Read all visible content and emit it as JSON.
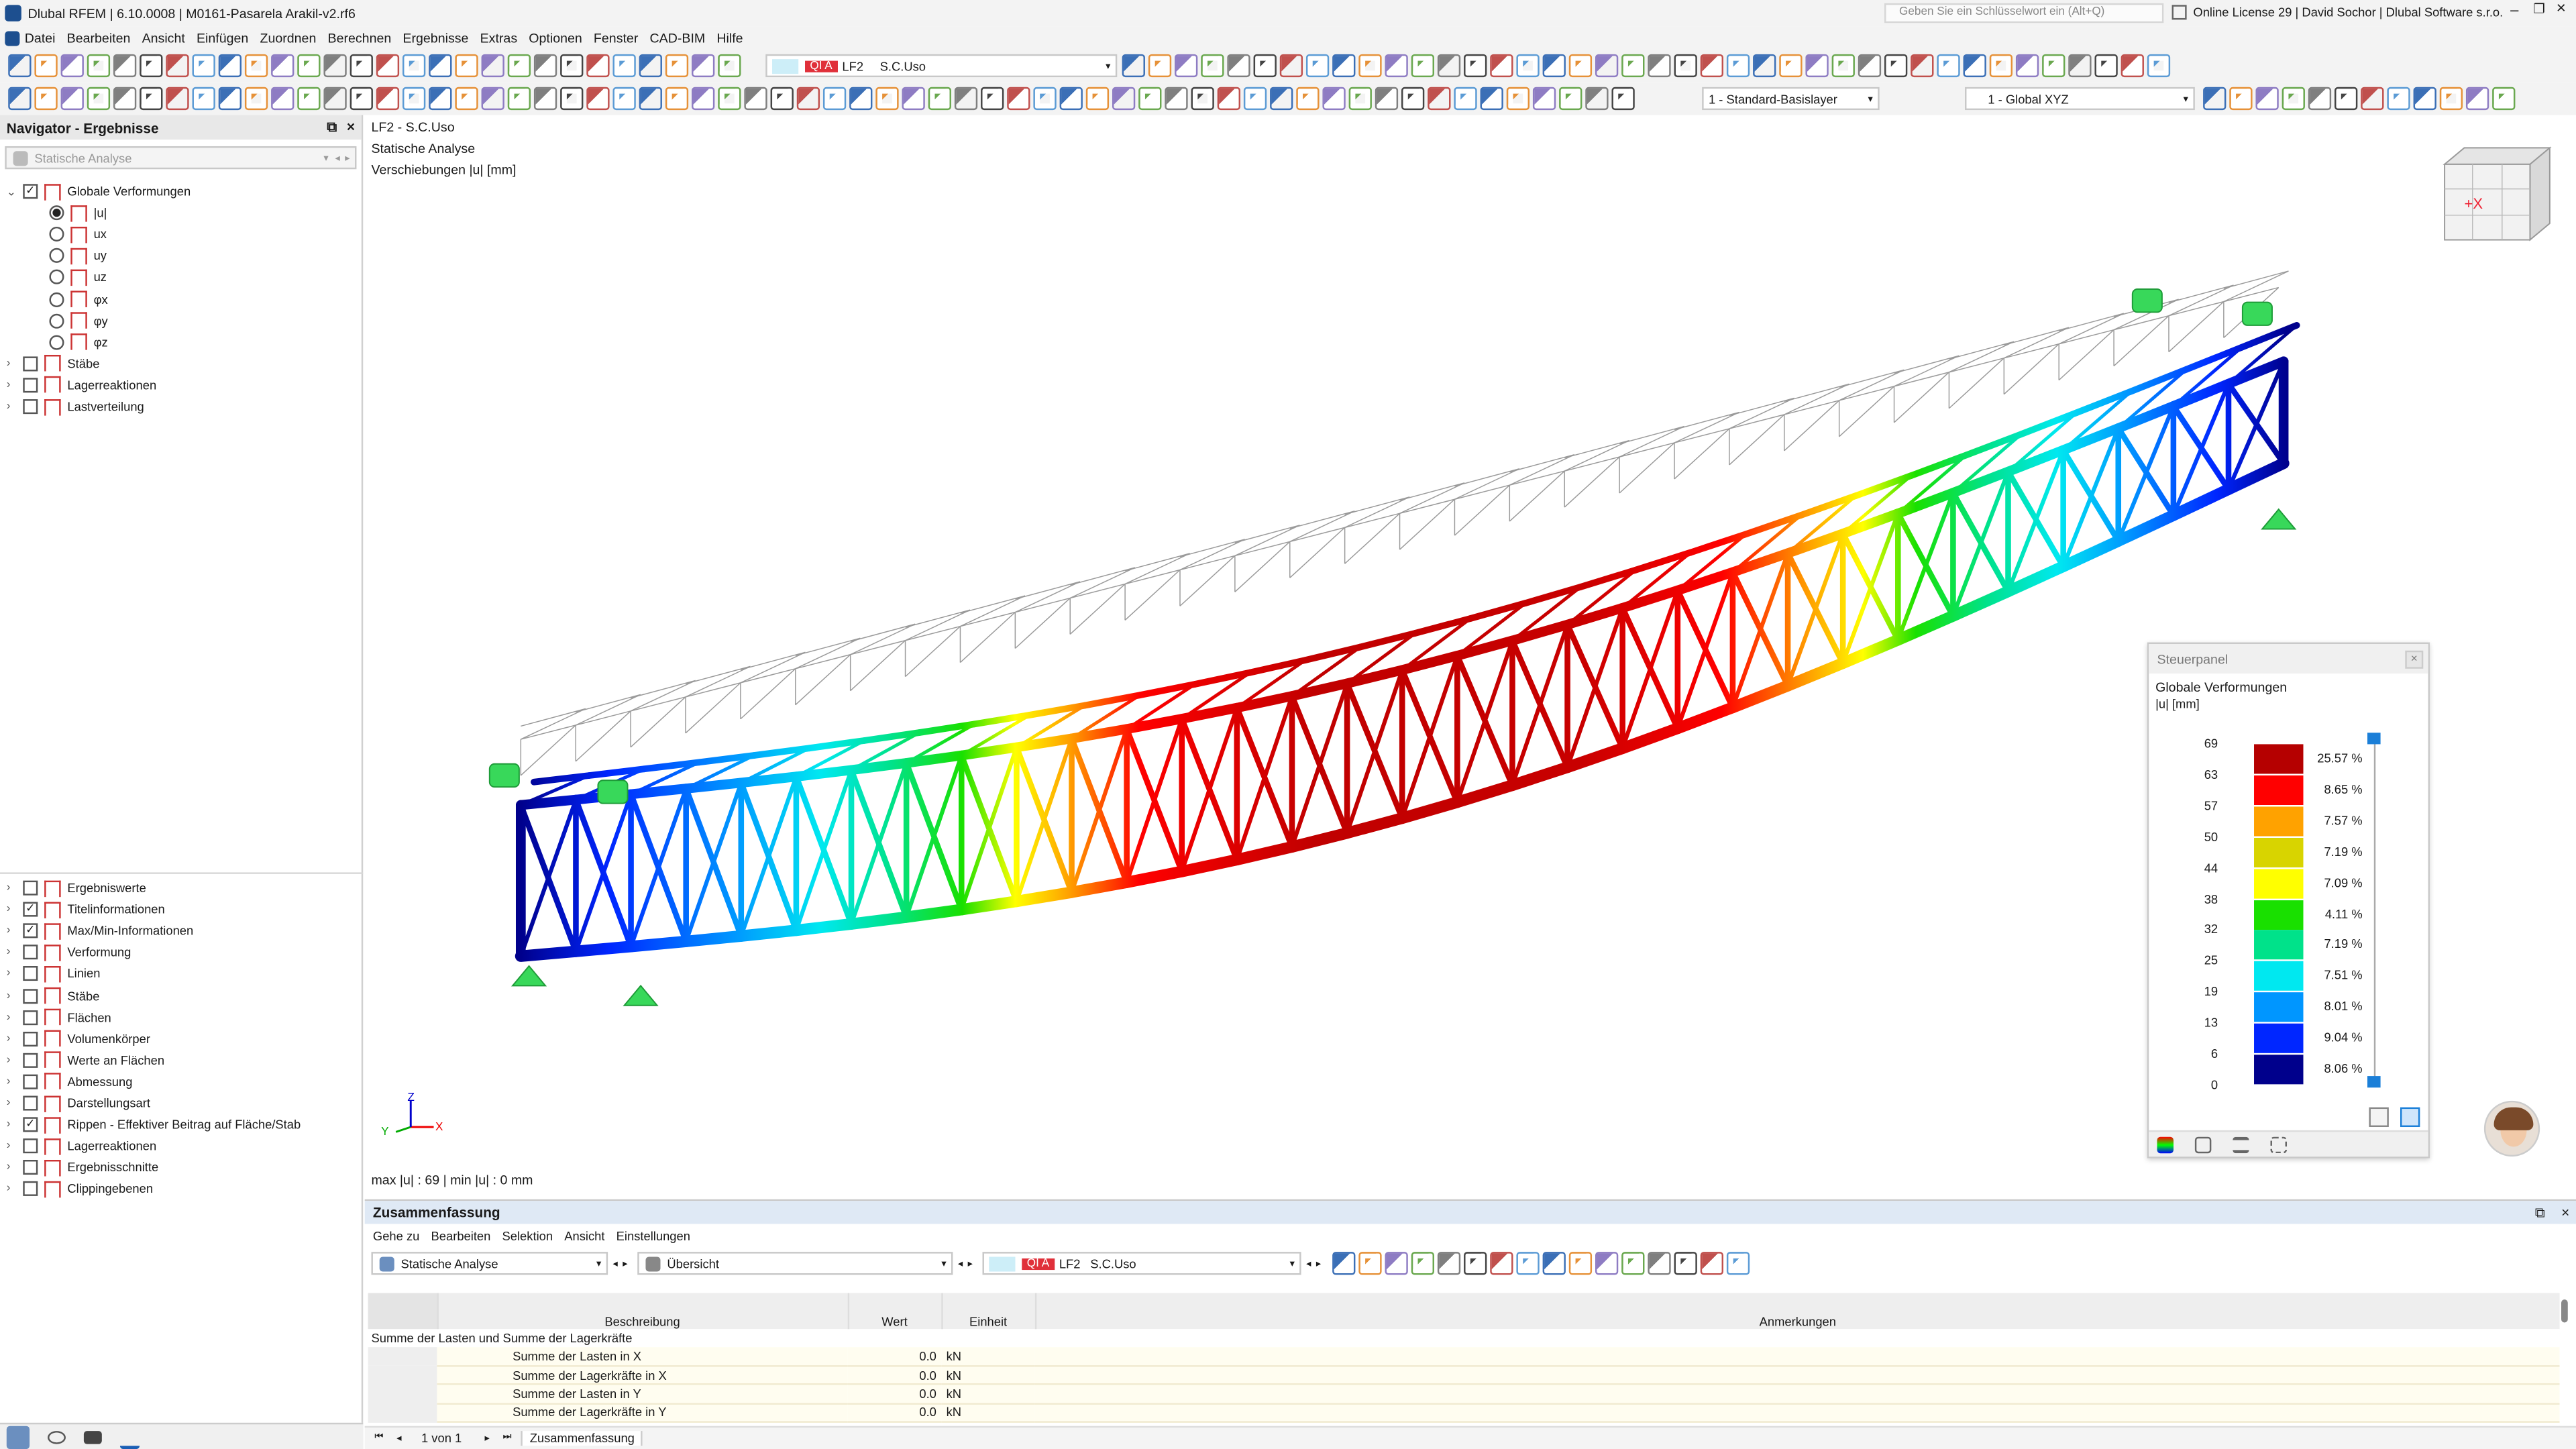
{
  "app": {
    "title": "Dlubal RFEM | 6.10.0008 | M0161-Pasarela Arakil-v2.rf6",
    "search_placeholder": "Geben Sie ein Schlüsselwort ein (Alt+Q)",
    "license": "Online License 29 | David Sochor | Dlubal Software s.r.o."
  },
  "menu": [
    "Datei",
    "Bearbeiten",
    "Ansicht",
    "Einfügen",
    "Zuordnen",
    "Berechnen",
    "Ergebnisse",
    "Extras",
    "Optionen",
    "Fenster",
    "CAD-BIM",
    "Hilfe"
  ],
  "toolbar": {
    "lc_badge": "QI A",
    "lc_id": "LF2",
    "lc_name": "S.C.Uso",
    "layer": "1 - Standard-Basislayer",
    "coord": "1 - Global XYZ"
  },
  "navigator": {
    "title": "Navigator - Ergebnisse",
    "analysis": "Statische Analyse",
    "tree": [
      {
        "label": "Globale Verformungen",
        "checked": true
      },
      {
        "label": "|u|",
        "radio": true,
        "on": true
      },
      {
        "label": "ux",
        "radio": true
      },
      {
        "label": "uy",
        "radio": true
      },
      {
        "label": "uz",
        "radio": true
      },
      {
        "label": "φx",
        "radio": true
      },
      {
        "label": "φy",
        "radio": true
      },
      {
        "label": "φz",
        "radio": true
      },
      {
        "label": "Stäbe"
      },
      {
        "label": "Lagerreaktionen"
      },
      {
        "label": "Lastverteilung"
      }
    ],
    "tree2": [
      {
        "label": "Ergebniswerte"
      },
      {
        "label": "Titelinformationen",
        "checked": true
      },
      {
        "label": "Max/Min-Informationen",
        "checked": true
      },
      {
        "label": "Verformung"
      },
      {
        "label": "Linien"
      },
      {
        "label": "Stäbe"
      },
      {
        "label": "Flächen"
      },
      {
        "label": "Volumenkörper"
      },
      {
        "label": "Werte an Flächen"
      },
      {
        "label": "Abmessung"
      },
      {
        "label": "Darstellungsart"
      },
      {
        "label": "Rippen - Effektiver Beitrag auf Fläche/Stab",
        "checked": true
      },
      {
        "label": "Lagerreaktionen"
      },
      {
        "label": "Ergebnisschnitte"
      },
      {
        "label": "Clippingebenen"
      }
    ]
  },
  "viewport": {
    "line1": "LF2 - S.C.Uso",
    "line2": "Statische Analyse",
    "line3": "Verschiebungen |u| [mm]",
    "maxmin": "max |u| : 69 | min |u| : 0 mm",
    "cube_x": "+X",
    "axis_x": "X",
    "axis_y": "Y",
    "axis_z": "Z"
  },
  "control_panel": {
    "title": "Steuerpanel",
    "heading": "Globale Verformungen",
    "unit": "|u| [mm]",
    "levels": [
      "69",
      "63",
      "57",
      "50",
      "44",
      "38",
      "32",
      "25",
      "19",
      "13",
      "6",
      "0"
    ],
    "bands": [
      {
        "color": "#b50000",
        "pct": "25.57 %"
      },
      {
        "color": "#ff0000",
        "pct": "8.65 %"
      },
      {
        "color": "#ffa200",
        "pct": "7.57 %"
      },
      {
        "color": "#d8d400",
        "pct": "7.19 %"
      },
      {
        "color": "#ffff00",
        "pct": "7.09 %"
      },
      {
        "color": "#19e000",
        "pct": "4.11 %"
      },
      {
        "color": "#00e28a",
        "pct": "7.19 %"
      },
      {
        "color": "#00e8f0",
        "pct": "7.51 %"
      },
      {
        "color": "#0096ff",
        "pct": "8.01 %"
      },
      {
        "color": "#0026ff",
        "pct": "9.04 %"
      },
      {
        "color": "#00008c",
        "pct": "8.06 %"
      }
    ]
  },
  "summary": {
    "title": "Zusammenfassung",
    "menu": [
      "Gehe zu",
      "Bearbeiten",
      "Selektion",
      "Ansicht",
      "Einstellungen"
    ],
    "analysis": "Statische Analyse",
    "view": "Übersicht",
    "lc_badge": "QI A",
    "lc_id": "LF2",
    "lc_name": "S.C.Uso",
    "headers": [
      "Beschreibung",
      "Wert",
      "Einheit",
      "Anmerkungen"
    ],
    "group": "Summe der Lasten und Summe der Lagerkräfte",
    "rows": [
      {
        "desc": "Summe der Lasten in X",
        "val": "0.0",
        "unit": "kN"
      },
      {
        "desc": "Summe der Lagerkräfte in X",
        "val": "0.0",
        "unit": "kN"
      },
      {
        "desc": "Summe der Lasten in Y",
        "val": "0.0",
        "unit": "kN"
      },
      {
        "desc": "Summe der Lagerkräfte in Y",
        "val": "0.0",
        "unit": "kN"
      }
    ],
    "pager": "1 von 1",
    "tab": "Zusammenfassung"
  }
}
